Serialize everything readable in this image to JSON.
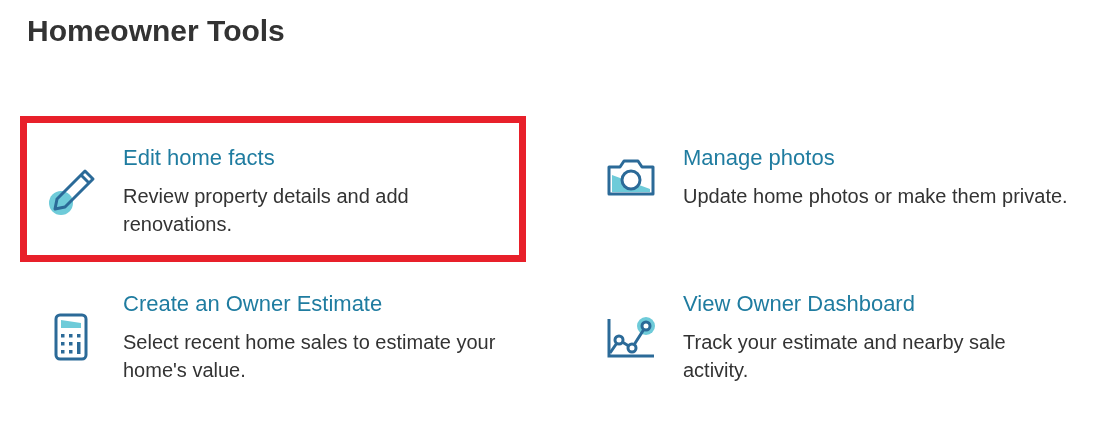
{
  "heading": "Homeowner Tools",
  "tools": [
    {
      "kind": "pencil",
      "title": "Edit home facts",
      "description": "Review property details and add renovations.",
      "highlighted": true
    },
    {
      "kind": "camera",
      "title": "Manage photos",
      "description": "Update home photos or make them private.",
      "highlighted": false
    },
    {
      "kind": "calculator",
      "title": "Create an Owner Estimate",
      "description": "Select recent home sales to estimate your home's value.",
      "highlighted": false
    },
    {
      "kind": "chart",
      "title": "View Owner Dashboard",
      "description": "Track your estimate and nearby sale activity.",
      "highlighted": false
    }
  ]
}
